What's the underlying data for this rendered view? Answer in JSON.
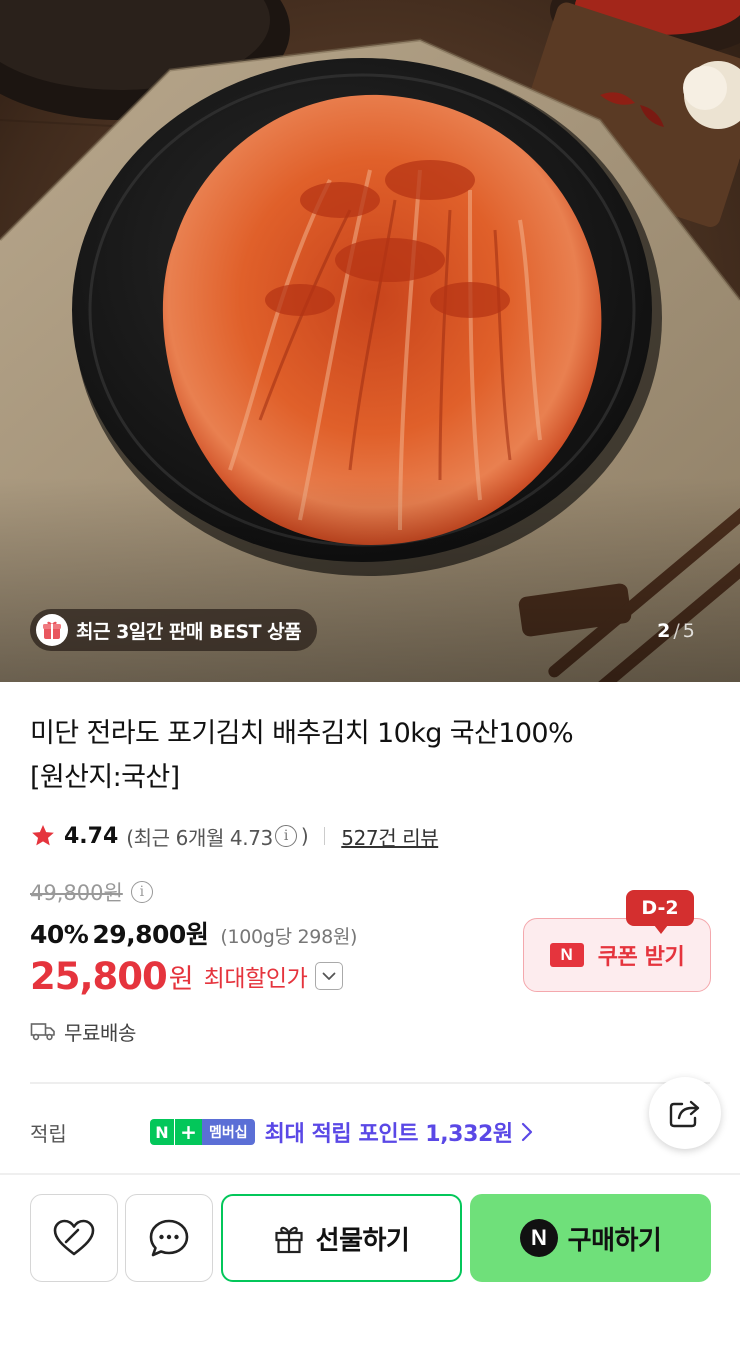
{
  "hero": {
    "badge_text": "최근 3일간 판매 BEST 상품",
    "badge_icon": "gift-box-icon",
    "pager_current": "2",
    "pager_separator": "/",
    "pager_total": "5"
  },
  "product": {
    "title_line1": "미단 전라도 포기김치 배추김치 10kg 국산100%",
    "title_line2": "[원산지:국산]",
    "rating": "4.74",
    "recent_rating_prefix": "(최근 6개월 4.73",
    "recent_rating_suffix": ")",
    "review_count": "527건 리뷰",
    "original_price": "49,800원",
    "discount_percent": "40%",
    "sale_price": "29,800원",
    "unit_price": "(100g당 298원)",
    "max_discount_price": "25,800",
    "max_discount_unit": "원",
    "max_discount_label": "최대할인가",
    "shipping": "무료배송"
  },
  "coupon": {
    "badge": "N",
    "label": "쿠폰 받기",
    "dday": "D-2"
  },
  "points": {
    "label": "적립",
    "np_n": "N",
    "np_plus": "+",
    "np_membership": "멤버십",
    "text": "최대 적립 포인트 1,332원"
  },
  "actions": {
    "gift_label": "선물하기",
    "buy_label": "구매하기",
    "buy_badge": "N"
  },
  "colors": {
    "accent_red": "#e5343d",
    "naver_green": "#03c75a",
    "buy_green": "#6fe07a",
    "points_purple": "#5a48e6"
  }
}
